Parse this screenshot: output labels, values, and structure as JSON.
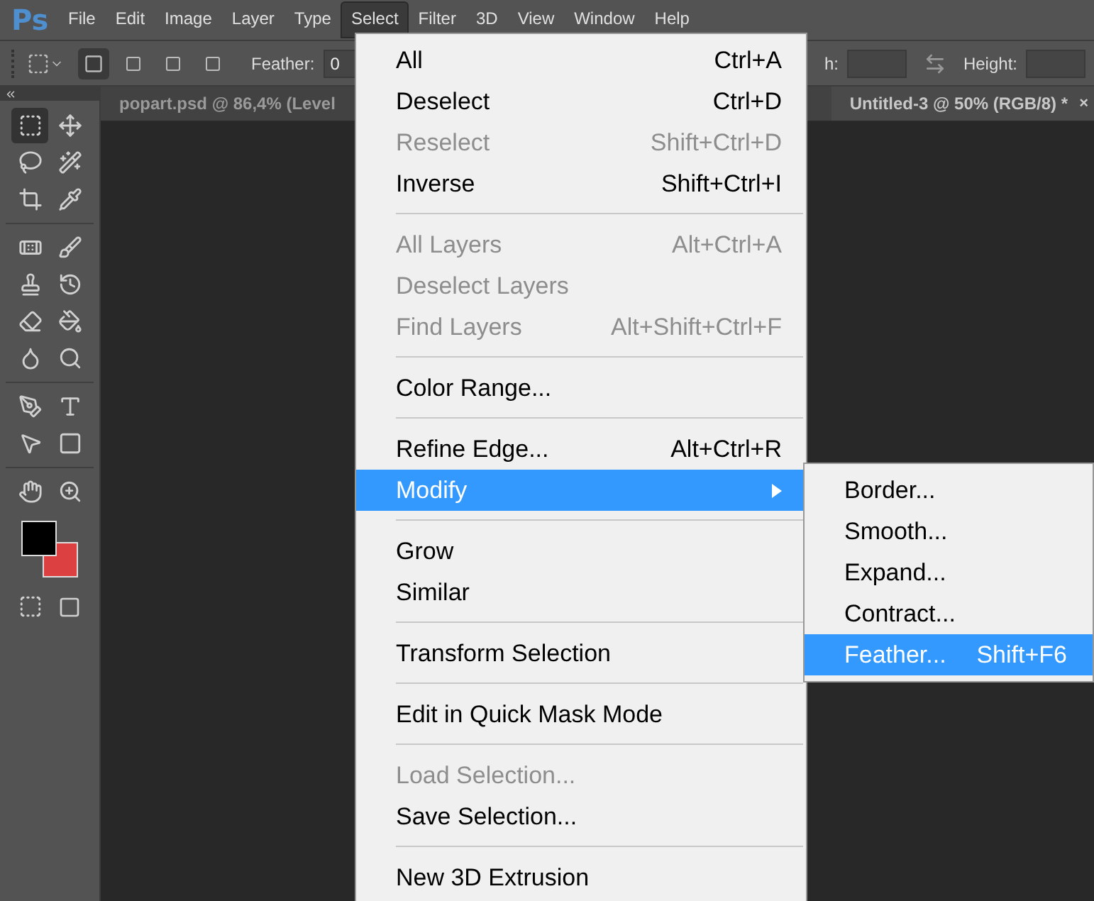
{
  "app_logo": "Ps",
  "menu_bar": [
    {
      "label": "File",
      "selected": false
    },
    {
      "label": "Edit",
      "selected": false
    },
    {
      "label": "Image",
      "selected": false
    },
    {
      "label": "Layer",
      "selected": false
    },
    {
      "label": "Type",
      "selected": false
    },
    {
      "label": "Select",
      "selected": true
    },
    {
      "label": "Filter",
      "selected": false
    },
    {
      "label": "3D",
      "selected": false
    },
    {
      "label": "View",
      "selected": false
    },
    {
      "label": "Window",
      "selected": false
    },
    {
      "label": "Help",
      "selected": false
    }
  ],
  "options_bar": {
    "feather_label": "Feather:",
    "feather_value": "0",
    "width_label": "h:",
    "height_label": "Height:"
  },
  "document_tabs": [
    {
      "title": "popart.psd @ 86,4% (Level",
      "selected": false
    },
    {
      "title": "Untitled-3 @ 50% (RGB/8) *",
      "selected": true,
      "close": "×"
    }
  ],
  "select_menu": [
    {
      "kind": "item",
      "label": "All",
      "shortcut": "Ctrl+A",
      "disabled": false,
      "selected": false
    },
    {
      "kind": "item",
      "label": "Deselect",
      "shortcut": "Ctrl+D",
      "disabled": false,
      "selected": false
    },
    {
      "kind": "item",
      "label": "Reselect",
      "shortcut": "Shift+Ctrl+D",
      "disabled": true,
      "selected": false
    },
    {
      "kind": "item",
      "label": "Inverse",
      "shortcut": "Shift+Ctrl+I",
      "disabled": false,
      "selected": false
    },
    {
      "kind": "separator"
    },
    {
      "kind": "item",
      "label": "All Layers",
      "shortcut": "Alt+Ctrl+A",
      "disabled": true,
      "selected": false
    },
    {
      "kind": "item",
      "label": "Deselect Layers",
      "disabled": true,
      "selected": false
    },
    {
      "kind": "item",
      "label": "Find Layers",
      "shortcut": "Alt+Shift+Ctrl+F",
      "disabled": true,
      "selected": false
    },
    {
      "kind": "separator"
    },
    {
      "kind": "item",
      "label": "Color Range...",
      "disabled": false,
      "selected": false
    },
    {
      "kind": "separator"
    },
    {
      "kind": "item",
      "label": "Refine Edge...",
      "shortcut": "Alt+Ctrl+R",
      "disabled": false,
      "selected": false
    },
    {
      "kind": "submenu",
      "label": "Modify",
      "disabled": false,
      "selected": true
    },
    {
      "kind": "separator"
    },
    {
      "kind": "item",
      "label": "Grow",
      "disabled": false,
      "selected": false
    },
    {
      "kind": "item",
      "label": "Similar",
      "disabled": false,
      "selected": false
    },
    {
      "kind": "separator"
    },
    {
      "kind": "item",
      "label": "Transform Selection",
      "disabled": false,
      "selected": false
    },
    {
      "kind": "separator"
    },
    {
      "kind": "item",
      "label": "Edit in Quick Mask Mode",
      "disabled": false,
      "selected": false
    },
    {
      "kind": "separator"
    },
    {
      "kind": "item",
      "label": "Load Selection...",
      "disabled": true,
      "selected": false
    },
    {
      "kind": "item",
      "label": "Save Selection...",
      "disabled": false,
      "selected": false
    },
    {
      "kind": "separator"
    },
    {
      "kind": "item",
      "label": "New 3D Extrusion",
      "disabled": false,
      "selected": false
    }
  ],
  "modify_submenu": [
    {
      "label": "Border...",
      "selected": false
    },
    {
      "label": "Smooth...",
      "selected": false
    },
    {
      "label": "Expand...",
      "selected": false
    },
    {
      "label": "Contract...",
      "selected": false
    },
    {
      "label": "Feather...",
      "shortcut": "Shift+F6",
      "selected": true
    }
  ]
}
